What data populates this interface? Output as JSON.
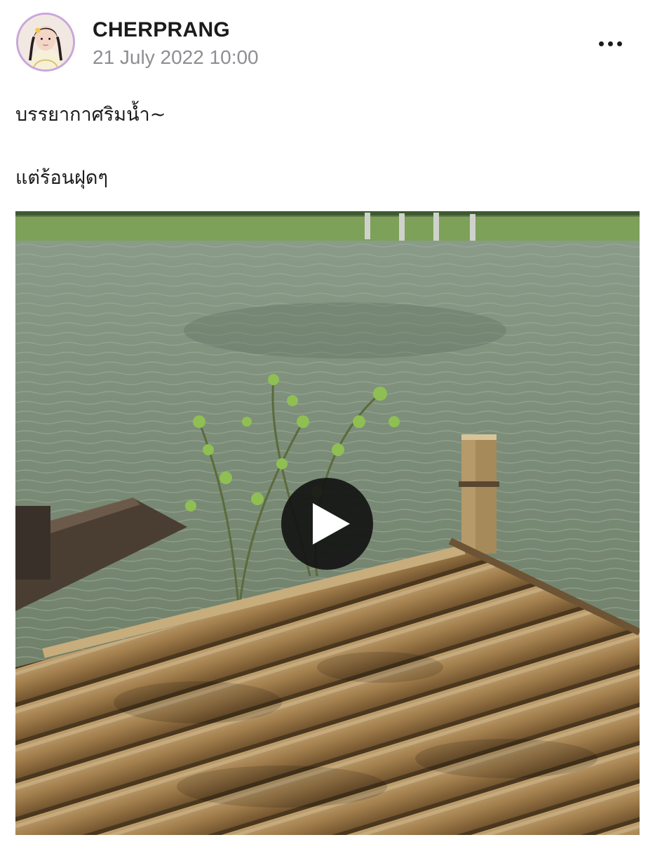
{
  "post": {
    "author": "CHERPRANG",
    "timestamp": "21 July 2022 10:00",
    "caption_lines": [
      "บรรยากาศริมน้ำ~",
      "แต่ร้อนฝุดๆ"
    ]
  },
  "icons": {
    "more": "more-horizontal-icon",
    "play": "play-icon"
  },
  "colors": {
    "avatar_ring": "#c9a6dd",
    "timestamp": "#8e8e93",
    "play_background": "#1a1a1a"
  }
}
